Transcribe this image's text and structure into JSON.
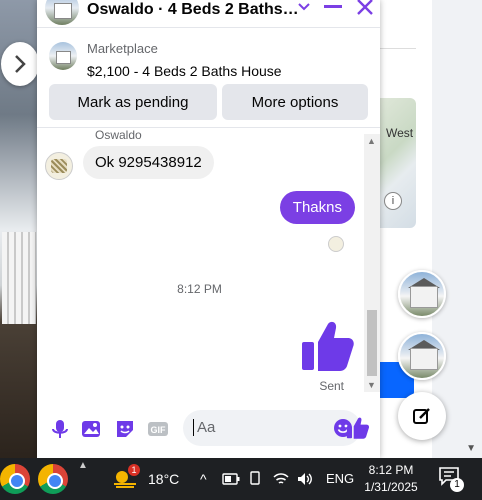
{
  "background": {
    "map_label": "West",
    "map_info": "i"
  },
  "chat": {
    "title": "Oswaldo · 4 Beds 2 Baths ···",
    "listing": {
      "kicker": "Marketplace",
      "title": "$2,100 - 4 Beds 2 Baths House"
    },
    "actions": {
      "mark_pending": "Mark as pending",
      "more_options": "More options"
    },
    "messages": {
      "sender_name": "Oswaldo",
      "received_text": "Ok 9295438912",
      "sent_text": "Thakns",
      "timestamp": "8:12 PM",
      "status": "Sent"
    },
    "composer": {
      "placeholder": "Aa"
    },
    "accent_color": "#7b3fe4"
  },
  "taskbar": {
    "weather_badge": "1",
    "temperature": "18°C",
    "language": "ENG",
    "time": "8:12 PM",
    "date": "1/31/2025",
    "notification_count": "1"
  }
}
